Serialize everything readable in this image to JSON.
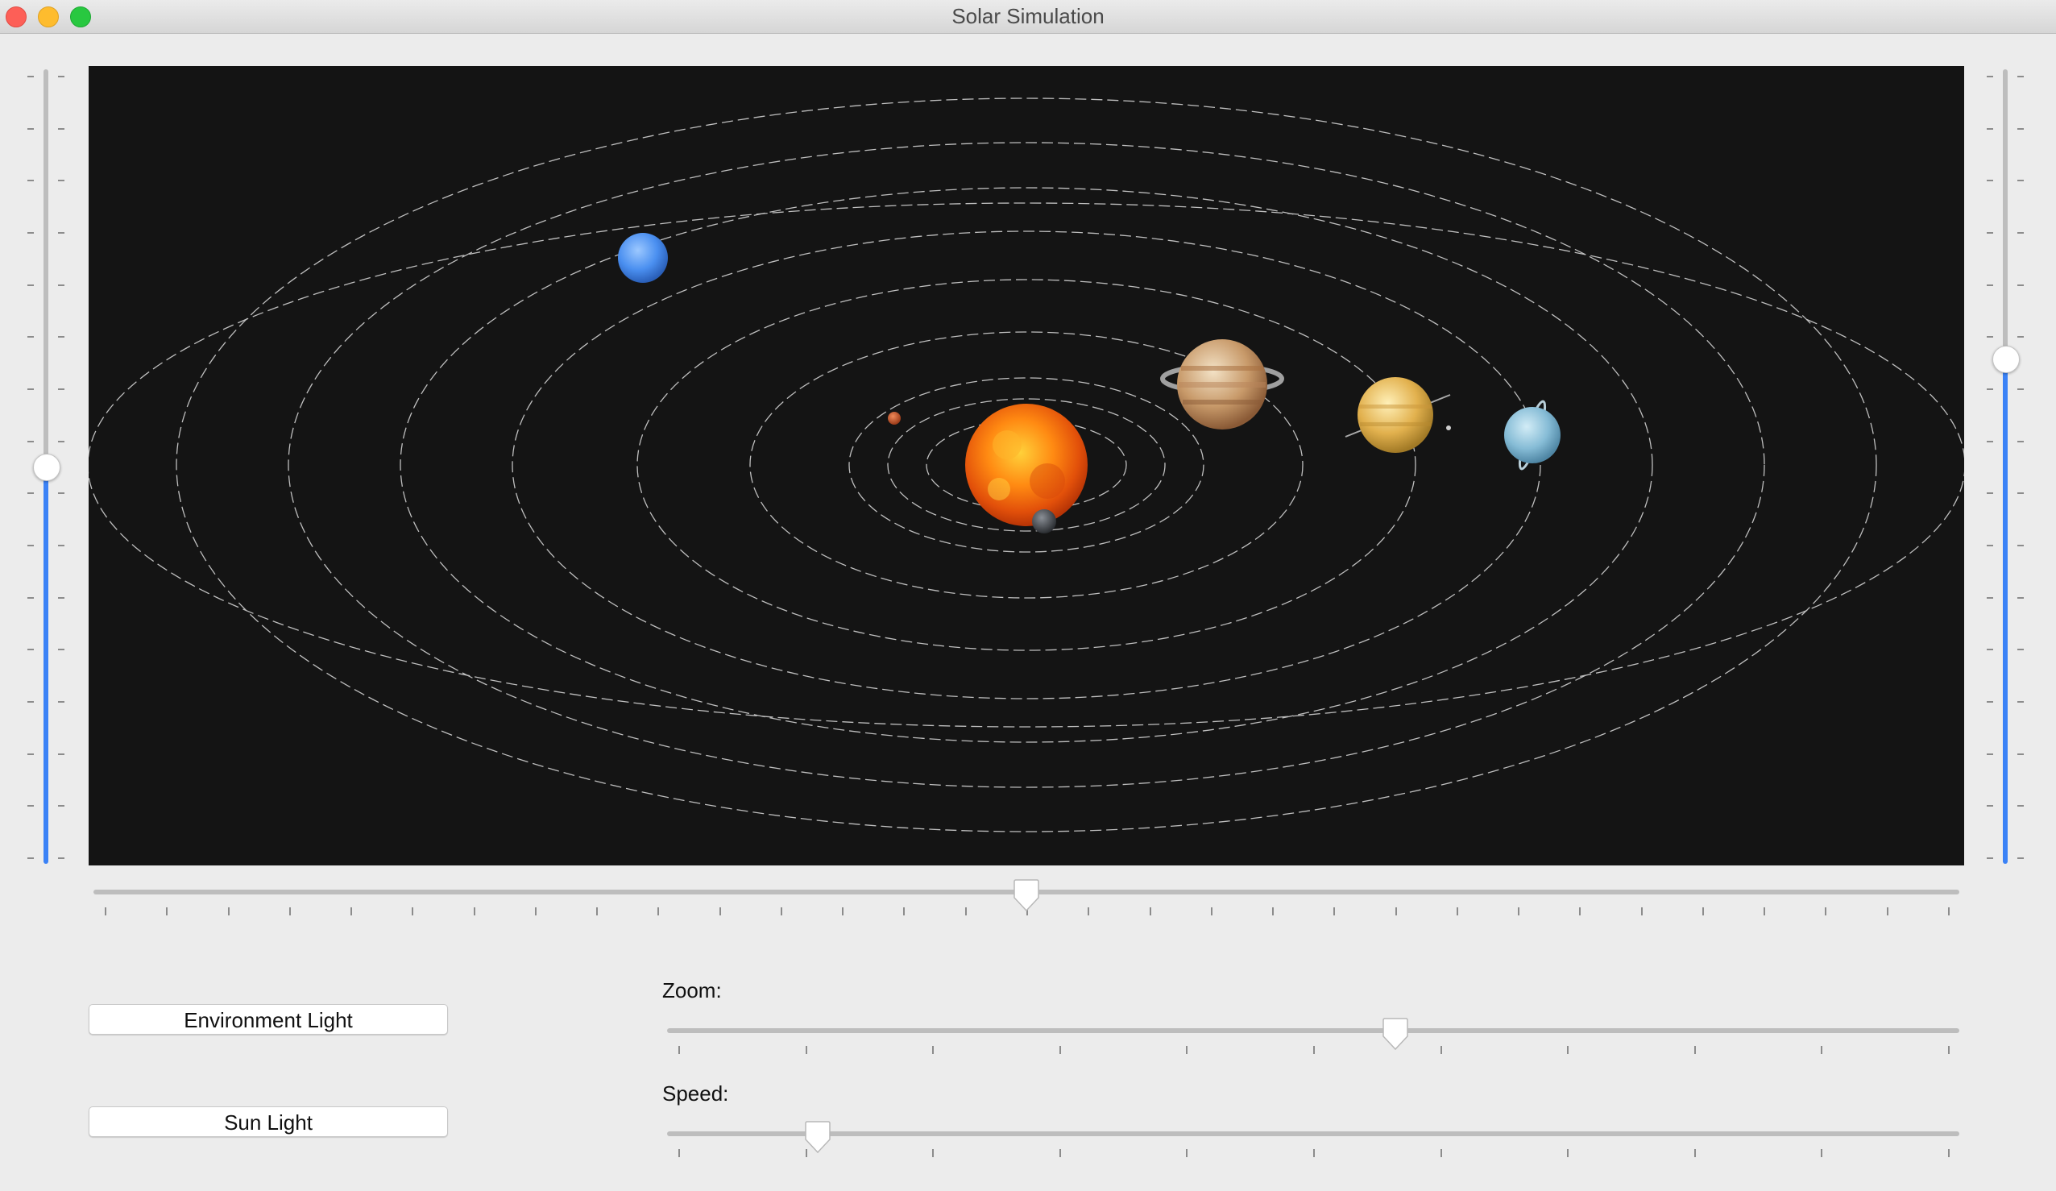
{
  "window": {
    "title": "Solar Simulation"
  },
  "viewport": {
    "background": "#141414",
    "planets": [
      "sun",
      "mercury",
      "venus",
      "earth",
      "mars",
      "jupiter",
      "saturn",
      "uranus",
      "neptune"
    ]
  },
  "controls": {
    "environment_light_label": "Environment Light",
    "sun_light_label": "Sun Light",
    "zoom_label": "Zoom:",
    "speed_label": "Speed:",
    "zoom_value": 0.565,
    "speed_value": 0.108,
    "rotation_value": 0.5,
    "left_vertical_value": 0.5,
    "right_vertical_value": 0.64
  },
  "colors": {
    "accent": "#3b82f6",
    "track": "#bdbdbd",
    "window_bg": "#ececec"
  }
}
